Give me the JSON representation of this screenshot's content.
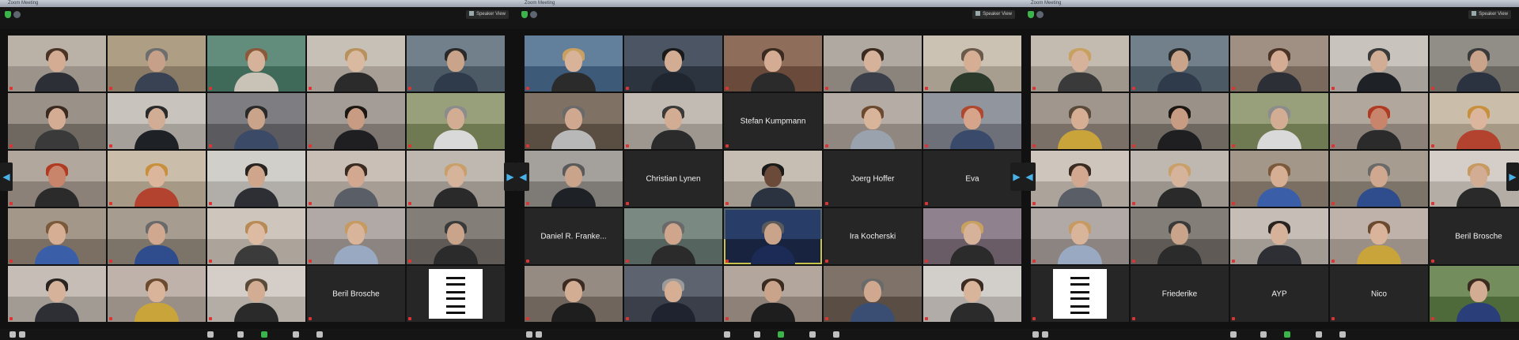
{
  "windows": [
    {
      "title": "Zoom Meeting",
      "view_label": "Speaker View",
      "tiles": [
        {
          "type": "video",
          "name": "",
          "bg": "#9c938a",
          "wall": "#c4bbb0",
          "skin": "#d3ac93",
          "hair": "#4a3426",
          "shirt": "#2c2f36"
        },
        {
          "type": "video",
          "name": "",
          "bg": "#8a7b66",
          "wall": "#b8a98f",
          "skin": "#c7a08a",
          "hair": "#6e6e6e",
          "shirt": "#394252"
        },
        {
          "type": "video",
          "name": "",
          "bg": "#3f6a5a",
          "wall": "#6f9a88",
          "skin": "#d6b29a",
          "hair": "#8a5a3a",
          "shirt": "#c9c2b6"
        },
        {
          "type": "video",
          "name": "",
          "bg": "#a79f96",
          "wall": "#d2cbc2",
          "skin": "#d9b9a0",
          "hair": "#b8925e",
          "shirt": "#2b2b2b"
        },
        {
          "type": "video",
          "name": "",
          "bg": "#4c5a66",
          "wall": "#7f8d98",
          "skin": "#c9a48a",
          "hair": "#2a2a2a",
          "shirt": "#2f3a4a"
        },
        {
          "type": "video",
          "name": "",
          "bg": "#6f6861",
          "wall": "#a8a097",
          "skin": "#d3ac93",
          "hair": "#3b2a20",
          "shirt": "#3a3a3a"
        },
        {
          "type": "video",
          "name": "",
          "bg": "#a5a09a",
          "wall": "#d4cfc8",
          "skin": "#d1ad96",
          "hair": "#2a2a2a",
          "shirt": "#1e2126"
        },
        {
          "type": "video",
          "name": "",
          "bg": "#5b5a5e",
          "wall": "#8a898d",
          "skin": "#c9a48a",
          "hair": "#2a2a2a",
          "shirt": "#3b4a66"
        },
        {
          "type": "video",
          "name": "",
          "bg": "#7d7670",
          "wall": "#b1aaa3",
          "skin": "#c79c82",
          "hair": "#1d1714",
          "shirt": "#1f1f22"
        },
        {
          "type": "video",
          "name": "",
          "bg": "#6f7a52",
          "wall": "#a5ae8a",
          "skin": "#d2ad93",
          "hair": "#8c8c8c",
          "shirt": "#d9d9d9"
        },
        {
          "type": "video",
          "name": "",
          "bg": "#8b8178",
          "wall": "#bdb4aa",
          "skin": "#c9856c",
          "hair": "#b03a22",
          "shirt": "#2b2b2b"
        },
        {
          "type": "video",
          "name": "",
          "bg": "#a69a86",
          "wall": "#d6cab6",
          "skin": "#dcb69c",
          "hair": "#c8903c",
          "shirt": "#b3422f"
        },
        {
          "type": "video",
          "name": "",
          "bg": "#b1aea9",
          "wall": "#dcd9d4",
          "skin": "#cfa68c",
          "hair": "#2a2421",
          "shirt": "#2d2f34"
        },
        {
          "type": "video",
          "name": "",
          "bg": "#a69d94",
          "wall": "#d4cbc2",
          "skin": "#d2a990",
          "hair": "#3a2b22",
          "shirt": "#5a5e66"
        },
        {
          "type": "video",
          "name": "",
          "bg": "#9a948d",
          "wall": "#cac4bd",
          "skin": "#d6b49c",
          "hair": "#c9a06a",
          "shirt": "#2a2a2a"
        },
        {
          "type": "video",
          "name": "",
          "bg": "#7b6f64",
          "wall": "#b0a497",
          "skin": "#d5ae94",
          "hair": "#7a5a3a",
          "shirt": "#3a5ea8"
        },
        {
          "type": "video",
          "name": "",
          "bg": "#7c7468",
          "wall": "#b4ab9d",
          "skin": "#d0a88f",
          "hair": "#6a6a6a",
          "shirt": "#2f4c8c"
        },
        {
          "type": "video",
          "name": "",
          "bg": "#aca49a",
          "wall": "#d9d1c7",
          "skin": "#dcbba2",
          "hair": "#b78a56",
          "shirt": "#3b3b3b"
        },
        {
          "type": "video",
          "name": "",
          "bg": "#8b8480",
          "wall": "#bdb6b2",
          "skin": "#d8b49a",
          "hair": "#c69a60",
          "shirt": "#9aa9c2"
        },
        {
          "type": "video",
          "name": "",
          "bg": "#5f5a56",
          "wall": "#908b86",
          "skin": "#c9a48a",
          "hair": "#3a3a3a",
          "shirt": "#2b2b2b"
        },
        {
          "type": "video",
          "name": "",
          "bg": "#a29b93",
          "wall": "#d1cac2",
          "skin": "#d6b29a",
          "hair": "#2a2421",
          "shirt": "#2d2f34"
        },
        {
          "type": "video",
          "name": "",
          "bg": "#9a8f86",
          "wall": "#c9beb5",
          "skin": "#d9b49a",
          "hair": "#6b4a2f",
          "shirt": "#c8a43a"
        },
        {
          "type": "video",
          "name": "",
          "bg": "#b3ada6",
          "wall": "#e0dad3",
          "skin": "#d2ad93",
          "hair": "#5a4a3a",
          "shirt": "#2a2a2a"
        },
        {
          "type": "name",
          "name": "",
          "label": "Beril Brosche"
        },
        {
          "type": "logo",
          "name": ""
        }
      ]
    },
    {
      "title": "Zoom Meeting",
      "view_label": "Speaker View",
      "tiles": [
        {
          "type": "video",
          "name": "",
          "bg": "#3d5a78",
          "wall": "#6f8ca8",
          "skin": "#d8b39a",
          "hair": "#c8a060",
          "shirt": "#2b2b2b"
        },
        {
          "type": "video",
          "name": "",
          "bg": "#2c3440",
          "wall": "#566070",
          "skin": "#d2ad93",
          "hair": "#1a1a1a",
          "shirt": "#1f2630"
        },
        {
          "type": "video",
          "name": "",
          "bg": "#6a4a3a",
          "wall": "#9b7a66",
          "skin": "#d3ac93",
          "hair": "#3a2a20",
          "shirt": "#2b2b2b"
        },
        {
          "type": "video",
          "name": "",
          "bg": "#8a847d",
          "wall": "#bcb6af",
          "skin": "#d6b29a",
          "hair": "#3a2a20",
          "shirt": "#3a3f4a"
        },
        {
          "type": "video",
          "name": "",
          "bg": "#a89e90",
          "wall": "#d7cdbf",
          "skin": "#d5ae94",
          "hair": "#6a5a4a",
          "shirt": "#2c3a2c"
        },
        {
          "type": "video",
          "name": "",
          "bg": "#5a4e42",
          "wall": "#8c7f72",
          "skin": "#d0a88f",
          "hair": "#6a6a6a",
          "shirt": "#b8b8b8"
        },
        {
          "type": "video",
          "name": "",
          "bg": "#9d9790",
          "wall": "#cdc7c0",
          "skin": "#d2ad93",
          "hair": "#3a3a3a",
          "shirt": "#2b2b2b"
        },
        {
          "type": "name",
          "name": "",
          "label": "Stefan Kumpmann"
        },
        {
          "type": "video",
          "name": "",
          "bg": "#8f8780",
          "wall": "#c0b8b1",
          "skin": "#d8b49a",
          "hair": "#6b4a2f",
          "shirt": "#9aa3ad"
        },
        {
          "type": "video",
          "name": "",
          "bg": "#6d7078",
          "wall": "#9ea1a9",
          "skin": "#d6a48a",
          "hair": "#b0472f",
          "shirt": "#3a4a6a"
        },
        {
          "type": "video",
          "name": "",
          "bg": "#7e7a76",
          "wall": "#b2aeaa",
          "skin": "#c9a48a",
          "hair": "#5a5a5a",
          "shirt": "#1e2126"
        },
        {
          "type": "name",
          "name": "",
          "label": "Christian Lynen"
        },
        {
          "type": "video",
          "name": "",
          "bg": "#a29a8f",
          "wall": "#d2cabf",
          "skin": "#6b4a3a",
          "hair": "#1a1a1a",
          "shirt": "#2b3240"
        },
        {
          "type": "name",
          "name": "",
          "label": "Joerg Hoffer"
        },
        {
          "type": "name",
          "name": "",
          "label": "Eva"
        },
        {
          "type": "name",
          "name": "",
          "label": "Daniel R. Franke..."
        },
        {
          "type": "video",
          "name": "",
          "bg": "#56645f",
          "wall": "#88968f",
          "skin": "#cfa68c",
          "hair": "#6a6a6a",
          "shirt": "#2b2b2b"
        },
        {
          "type": "video",
          "name": "",
          "bg": "#17233f",
          "wall": "#2f4775",
          "skin": "#c9a48a",
          "hair": "#5a5a5a",
          "shirt": "#1c2b55",
          "active": true
        },
        {
          "type": "name",
          "name": "",
          "label": "Ira Kocherski"
        },
        {
          "type": "video",
          "name": "",
          "bg": "#6a5c67",
          "wall": "#9c8d99",
          "skin": "#d6b29a",
          "hair": "#c8a060",
          "shirt": "#2b2b2b"
        },
        {
          "type": "video",
          "name": "",
          "bg": "#6f655c",
          "wall": "#a39890",
          "skin": "#d2ad93",
          "hair": "#3a2a20",
          "shirt": "#1e1e1e"
        },
        {
          "type": "video",
          "name": "",
          "bg": "#3a3f4a",
          "wall": "#6a707c",
          "skin": "#d5ae94",
          "hair": "#9a9a9a",
          "shirt": "#1f2330"
        },
        {
          "type": "video",
          "name": "",
          "bg": "#8e8278",
          "wall": "#bfb3a9",
          "skin": "#c9a48a",
          "hair": "#3a2a20",
          "shirt": "#1e1e1e"
        },
        {
          "type": "video",
          "name": "",
          "bg": "#5a4e44",
          "wall": "#8c8076",
          "skin": "#d0a88f",
          "hair": "#6a6a6a",
          "shirt": "#3a4e74"
        },
        {
          "type": "video",
          "name": "",
          "bg": "#b1aca7",
          "wall": "#ded9d4",
          "skin": "#d8b49a",
          "hair": "#3a2a20",
          "shirt": "#2b2b2b"
        }
      ]
    },
    {
      "title": "Zoom Meeting",
      "view_label": "Speaker View",
      "tiles": [
        {
          "type": "video",
          "name": "",
          "bg": "#9f968c",
          "wall": "#cfc6bc",
          "skin": "#d6b29a",
          "hair": "#c8a060",
          "shirt": "#3a3a3a"
        },
        {
          "type": "video",
          "name": "",
          "bg": "#4c5a66",
          "wall": "#7f8d98",
          "skin": "#c9a48a",
          "hair": "#2a2a2a",
          "shirt": "#2f3a4a"
        },
        {
          "type": "video",
          "name": "",
          "bg": "#7a6a5e",
          "wall": "#ad9d91",
          "skin": "#d3ac93",
          "hair": "#4a3426",
          "shirt": "#2c2f36"
        },
        {
          "type": "video",
          "name": "",
          "bg": "#a5a09a",
          "wall": "#d4cfc8",
          "skin": "#d1ad96",
          "hair": "#3a3a3a",
          "shirt": "#1e2126"
        },
        {
          "type": "video",
          "name": "",
          "bg": "#6c6862",
          "wall": "#9e9a94",
          "skin": "#c9a48a",
          "hair": "#3a3a3a",
          "shirt": "#2b3240"
        },
        {
          "type": "video",
          "name": "",
          "bg": "#7a7068",
          "wall": "#aea39b",
          "skin": "#d5ae94",
          "hair": "#5a4a3a",
          "shirt": "#c8a43a"
        },
        {
          "type": "video",
          "name": "",
          "bg": "#6f6861",
          "wall": "#a8a097",
          "skin": "#c79c82",
          "hair": "#1d1714",
          "shirt": "#1f1f22"
        },
        {
          "type": "video",
          "name": "",
          "bg": "#6f7a52",
          "wall": "#a5ae8a",
          "skin": "#d2ad93",
          "hair": "#8c8c8c",
          "shirt": "#d9d9d9"
        },
        {
          "type": "video",
          "name": "",
          "bg": "#8b8178",
          "wall": "#bdb4aa",
          "skin": "#c9856c",
          "hair": "#b03a22",
          "shirt": "#2b2b2b"
        },
        {
          "type": "video",
          "name": "",
          "bg": "#a69a86",
          "wall": "#d6cab6",
          "skin": "#dcb69c",
          "hair": "#c8903c",
          "shirt": "#b3422f"
        },
        {
          "type": "video",
          "name": "",
          "bg": "#aca49a",
          "wall": "#d9d1c7",
          "skin": "#d2a990",
          "hair": "#3a2b22",
          "shirt": "#5a5e66"
        },
        {
          "type": "video",
          "name": "",
          "bg": "#9a948d",
          "wall": "#cac4bd",
          "skin": "#d6b49c",
          "hair": "#c9a06a",
          "shirt": "#2a2a2a"
        },
        {
          "type": "video",
          "name": "",
          "bg": "#7b6f64",
          "wall": "#b0a497",
          "skin": "#d5ae94",
          "hair": "#7a5a3a",
          "shirt": "#3a5ea8"
        },
        {
          "type": "video",
          "name": "",
          "bg": "#7c7468",
          "wall": "#b4ab9d",
          "skin": "#d0a88f",
          "hair": "#6a6a6a",
          "shirt": "#2f4c8c"
        },
        {
          "type": "video",
          "name": "",
          "bg": "#b3ada6",
          "wall": "#e0dad3",
          "skin": "#d2ad93",
          "hair": "#c69a60",
          "shirt": "#2a2a2a"
        },
        {
          "type": "video",
          "name": "",
          "bg": "#8b8480",
          "wall": "#bdb6b2",
          "skin": "#d8b49a",
          "hair": "#c69a60",
          "shirt": "#9aa9c2"
        },
        {
          "type": "video",
          "name": "",
          "bg": "#5f5a56",
          "wall": "#908b86",
          "skin": "#c9a48a",
          "hair": "#3a3a3a",
          "shirt": "#2b2b2b"
        },
        {
          "type": "video",
          "name": "",
          "bg": "#a29b93",
          "wall": "#d1cac2",
          "skin": "#d6b29a",
          "hair": "#2a2421",
          "shirt": "#2d2f34"
        },
        {
          "type": "video",
          "name": "",
          "bg": "#9a8f86",
          "wall": "#c9beb5",
          "skin": "#d9b49a",
          "hair": "#6b4a2f",
          "shirt": "#c8a43a"
        },
        {
          "type": "name",
          "name": "",
          "label": "Beril Brosche"
        },
        {
          "type": "logo",
          "name": ""
        },
        {
          "type": "name",
          "name": "",
          "label": "Friederike"
        },
        {
          "type": "name",
          "name": "",
          "label": "AYP"
        },
        {
          "type": "name",
          "name": "",
          "label": "Nico"
        },
        {
          "type": "video",
          "name": "",
          "bg": "#4f6a3a",
          "wall": "#7f9a6a",
          "skin": "#d2ad93",
          "hair": "#3a2a20",
          "shirt": "#2a3f7a"
        }
      ]
    }
  ],
  "icons": {
    "security": "shield-icon",
    "info": "info-icon",
    "view": "grid-icon",
    "prev_page": "chevron-left-icon",
    "next_page": "chevron-right-icon"
  },
  "colors": {
    "accent_green": "#3bb54a",
    "nav_blue": "#4ab0e8",
    "active_speaker": "#c7c24a",
    "mute_red": "#dd3333"
  }
}
